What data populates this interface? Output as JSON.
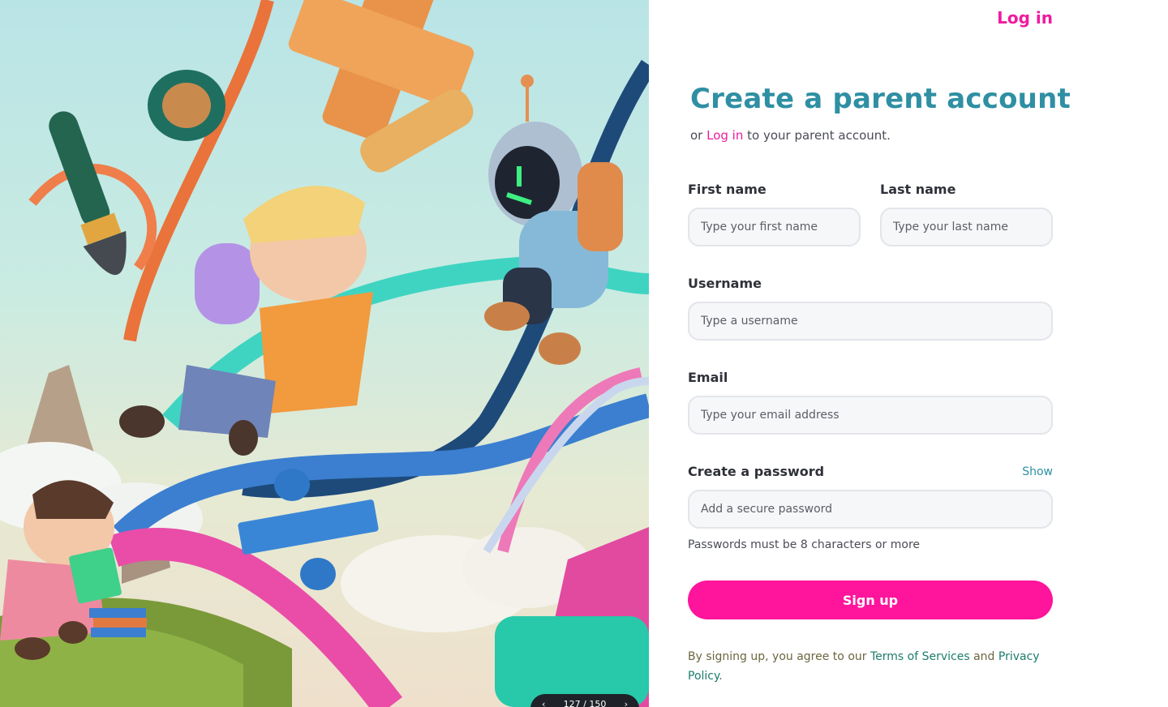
{
  "header": {
    "login_label": "Log in"
  },
  "form": {
    "title": "Create a parent account",
    "subtitle_prefix": "or ",
    "subtitle_link": "Log in",
    "subtitle_suffix": " to your parent account.",
    "first_name": {
      "label": "First name",
      "placeholder": "Type your first name",
      "value": ""
    },
    "last_name": {
      "label": "Last name",
      "placeholder": "Type your last name",
      "value": ""
    },
    "username": {
      "label": "Username",
      "placeholder": "Type a username",
      "value": ""
    },
    "email": {
      "label": "Email",
      "placeholder": "Type your email address",
      "value": ""
    },
    "password": {
      "label": "Create a password",
      "show_label": "Show",
      "placeholder": "Add a secure password",
      "value": "",
      "hint": "Passwords must be 8 characters or more"
    },
    "submit_label": "Sign up",
    "legal_prefix": "By signing up, you agree to our ",
    "terms_link": "Terms of Services",
    "legal_and": " and ",
    "privacy_link": "Privacy Policy",
    "legal_suffix": "."
  },
  "carousel": {
    "prev_icon": "chevron-left-icon",
    "next_icon": "chevron-right-icon",
    "counter": "127 / 150"
  },
  "colors": {
    "brand_pink": "#ff149c",
    "title_teal": "#2f8fa3",
    "link_pink": "#ef1b9f",
    "legal_link_green": "#1b7c6b"
  }
}
